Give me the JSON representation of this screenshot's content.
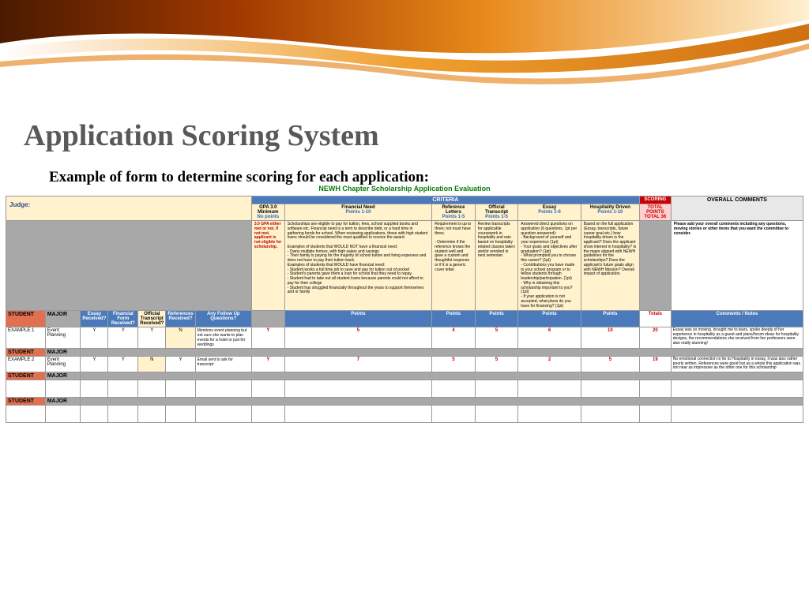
{
  "title": "Application Scoring System",
  "subtitle": "Example of form to determine scoring for each application:",
  "sheet": {
    "title": "NEWH Chapter Scholarship Application Evaluation",
    "judge_label": "Judge:",
    "criteria_label": "CRITERIA",
    "scoring_label": "SCORING",
    "overall_comments_label": "OVERALL COMMENTS",
    "criteria": [
      {
        "label": "GPA 3.0 Minimum",
        "range": "No points"
      },
      {
        "label": "Financial Need",
        "range": "Points 1-10"
      },
      {
        "label": "Reference Letters",
        "range": "Points 1-5"
      },
      {
        "label": "Official Transcript",
        "range": "Points 1-5"
      },
      {
        "label": "Essay",
        "range": "Points 1-6"
      },
      {
        "label": "Hospitality Driven",
        "range": "Points 1-10"
      }
    ],
    "total_header": "TOTAL POINTS TOTAL 36",
    "desc_gpa": "3.0 GPA either met or not. If not met, applicant is not eligible for scholarship.",
    "desc_fin": "Scholarships are eligible to pay for tuition, fees, school supplied books and software etc. Financial need is a term to describe debt, or a hard time in gathering funds for school. When reviewing applications, those with high student loans should be considered the most qualified to receive the award.\n\nExamples of students that WOULD NOT have a financial need:\n- Owns multiple homes, with high salary and savings\n- Their family is paying for the majority of school tuition and living expenses and does not have to pay their tuition back.\nExamples of students that WOULD have financial need:\n- Student works a full time job to save and pay for tuition out of pocket\n- Student's parents gave them a loan for school that they need to repay.\n- Student had to take out all student loans because parents could not afford to pay for their college\n- Student has struggled financially throughout the years to support themselves and or family",
    "desc_ref": "Requirement is up to three; not must have three.\n\n- Determine if the reference knows the student well and gave a custom and thoughtful response or if it is a generic cover letter.",
    "desc_tran": "Review transcripts for applicable coursework in hospitality and rate based on hospitality related classes taken and/or enrolled in next semester.",
    "desc_essay": "Answered direct questions on application (6 questions, 1pt per question answered):\n- Background of yourself and your experience (1pt)\n- Your goals and objectives after graduation? (1pt)\n- What prompted you to choose this career? (1pt)\n- Contributions you have made to your school program or to fellow students through leadership/participation. (1pt)\n- Why is obtaining this scholarship important to you? (1pt)\n- If your application is not accepted, what plans do you have for financing? (1pt)",
    "desc_hosp": "Based on the full application (Essay, transcripts, future career goal etc.) how hospitality driven is the applicant? Does the applicant show interest in hospitality? Is the major aligned with NEWH guidelines for the scholarships? Does the applicant's future goals align with NEWH Mission? Overall impact of application.",
    "desc_overall": "Please add your overall comments including any questions, moving stories or other items that you want the committee to consider.",
    "col_student": "STUDENT",
    "col_major": "MAJOR",
    "col_essay_recv": "Essay Received?",
    "col_fin_recv": "Financial Form Received?",
    "col_tran_recv": "Official Transcript Received?",
    "col_ref_recv": "References Received?",
    "col_followup": "Any Follow Up Questions?",
    "col_points": "Points",
    "col_totals": "Totals",
    "col_comments": "Comments / Notes",
    "rows": [
      {
        "student": "EXAMPLE 1",
        "major": "Event Planning",
        "essay_recv": "Y",
        "fin_recv": "Y",
        "tran_recv": "Y",
        "ref_recv": "N",
        "followup": "Mentions event planning but not sure she wants to plan events for a hotel or just for weddings",
        "gpa": "Y",
        "p_fin": "5",
        "p_ref": "4",
        "p_tran": "5",
        "p_essay": "6",
        "p_hosp": "10",
        "total": "20",
        "comments": "Essay was so moving, brought me to tears, spoke deeply of her experience in hospitality as a guest and plans/forum ideas for hospitality designs, the recommendations she received from her professors were also really stunning!"
      },
      {
        "student": "EXAMPLE 2",
        "major": "Event Planning",
        "essay_recv": "Y",
        "fin_recv": "Y",
        "tran_recv": "N",
        "ref_recv": "Y",
        "followup": "Email sent to ask for transcript",
        "gpa": "Y",
        "p_fin": "7",
        "p_ref": "5",
        "p_tran": "5",
        "p_essay": "2",
        "p_hosp": "5",
        "total": "19",
        "comments": "No emotional connection or tie to Hospitality in essay, it was also rather poorly written. References were good but as a whole this application was not near as impressive as the other one for this scholarship"
      }
    ]
  }
}
